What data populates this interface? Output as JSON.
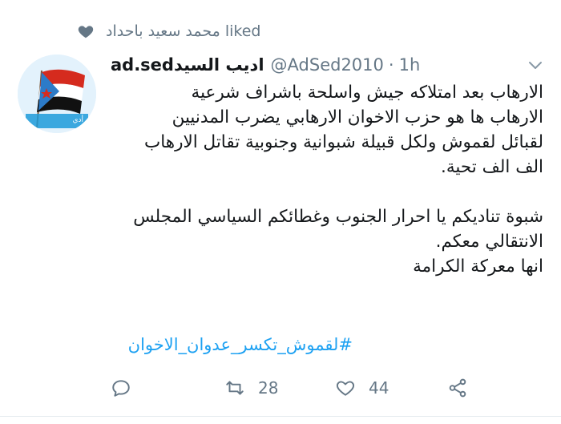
{
  "activity": {
    "liker_name": "محمد سعيد باحداد",
    "action_text": "liked",
    "icon": "heart-icon"
  },
  "tweet": {
    "display_name_latin": "ad.sed",
    "display_name_arabic": "اديب السيد",
    "handle": "@AdSed2010",
    "separator": "·",
    "time": "1h",
    "lines": [
      "الارهاب بعد امتلاكه جيش واسلحة باشراف شرعية",
      "الارهاب ها هو حزب الاخوان الارهابي يضرب المدنيين",
      "لقبائل لقموش ولكل قبيلة شبوانية وجنوبية تقاتل الارهاب",
      "الف الف تحية.",
      "",
      "شبوة تناديكم يا احرار الجنوب وغطائكم السياسي المجلس",
      "الانتقالي معكم.",
      "انها معركة الكرامة"
    ],
    "hashtag": "#لقموش_تكسر_عدوان_الاخوان"
  },
  "actions": {
    "reply_icon": "reply-icon",
    "retweet_icon": "retweet-icon",
    "retweet_count": "28",
    "like_icon": "like-icon",
    "like_count": "44",
    "share_icon": "share-icon"
  },
  "colors": {
    "accent": "#1da1f2",
    "muted": "#657786",
    "text": "#14171a"
  }
}
